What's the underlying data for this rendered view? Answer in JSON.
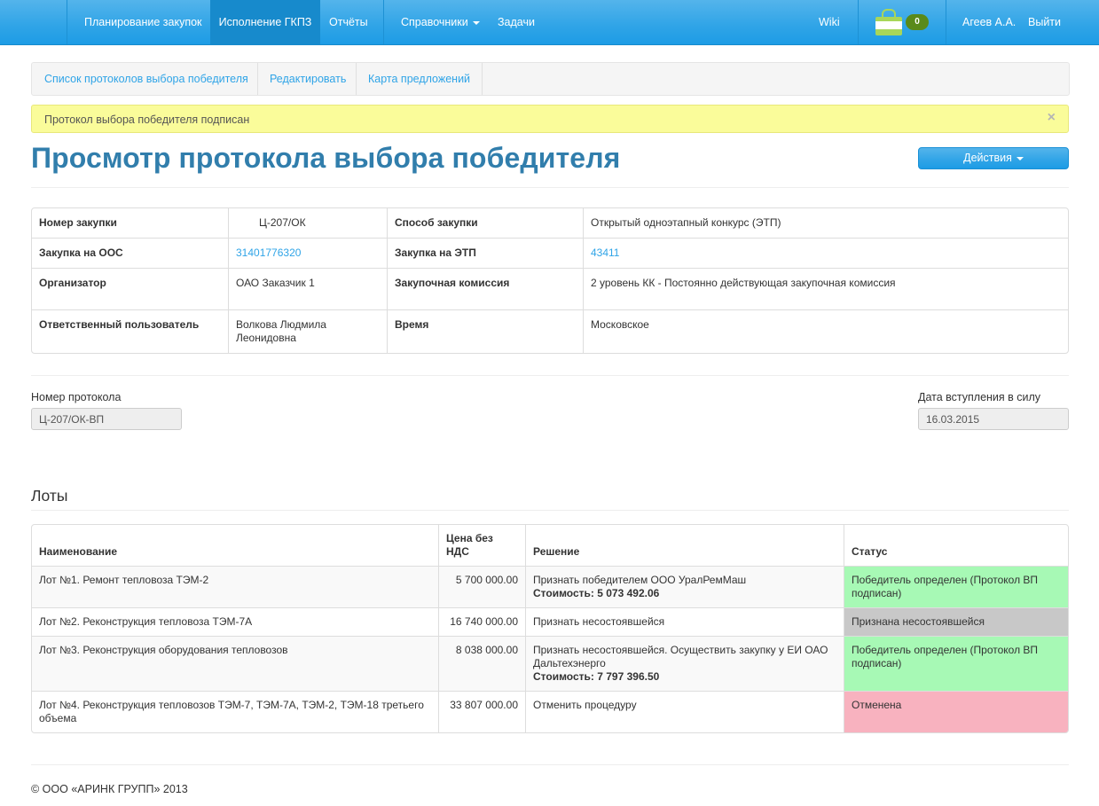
{
  "nav": {
    "planning": "Планирование закупок",
    "execution": "Исполнение ГКПЗ",
    "reports": "Отчёты",
    "references": "Справочники",
    "tasks": "Задачи",
    "wiki": "Wiki",
    "cart_count": "0",
    "user": "Агеев А.А.",
    "logout": "Выйти"
  },
  "subnav": {
    "list": "Список протоколов выбора победителя",
    "edit": "Редактировать",
    "map": "Карта предложений"
  },
  "alert": {
    "text": "Протокол выбора победителя подписан",
    "close": "×"
  },
  "page": {
    "title": "Просмотр протокола выбора победителя",
    "actions": "Действия"
  },
  "info": {
    "purchase_number_label": "Номер закупки",
    "purchase_number": "Ц-207/ОК",
    "method_label": "Способ закупки",
    "method": "Открытый одноэтапный конкурс (ЭТП)",
    "oos_label": "Закупка на ООС",
    "oos": "31401776320",
    "etp_label": "Закупка на ЭТП",
    "etp": "43411",
    "organizer_label": "Организатор",
    "organizer": "ОАО Заказчик 1",
    "commission_label": "Закупочная комиссия",
    "commission": "2 уровень КК - Постоянно действующая закупочная комиссия",
    "responsible_label": "Ответственный пользователь",
    "responsible": "Волкова Людмила Леонидовна",
    "time_label": "Время",
    "time": "Московское"
  },
  "protocol": {
    "number_label": "Номер протокола",
    "number": "Ц-207/ОК-ВП",
    "date_label": "Дата вступления в силу",
    "date": "16.03.2015"
  },
  "lots": {
    "title": "Лоты",
    "headers": {
      "name": "Наименование",
      "price": "Цена без НДС",
      "decision": "Решение",
      "status": "Статус"
    },
    "rows": [
      {
        "name": "Лот №1. Ремонт тепловоза ТЭМ-2",
        "price": "5 700 000.00",
        "decision": "Признать победителем ООО УралРемМаш",
        "cost": "Стоимость: 5 073 492.06",
        "status": "Победитель определен (Протокол ВП подписан)"
      },
      {
        "name": "Лот №2. Реконструкция тепловоза ТЭМ-7А",
        "price": "16 740 000.00",
        "decision": "Признать несостоявшейся",
        "cost": "",
        "status": "Признана несостоявшейся"
      },
      {
        "name": "Лот №3. Реконструкция оборудования тепловозов",
        "price": "8 038 000.00",
        "decision": "Признать несостоявшейся. Осуществить закупку у ЕИ ОАО Дальтехэнерго",
        "cost": "Стоимость: 7 797 396.50",
        "status": "Победитель определен (Протокол ВП подписан)"
      },
      {
        "name": "Лот №4. Реконструкция тепловозов ТЭМ-7, ТЭМ-7А, ТЭМ-2, ТЭМ-18 третьего объема",
        "price": "33 807 000.00",
        "decision": "Отменить процедуру",
        "cost": "",
        "status": "Отменена"
      }
    ]
  },
  "footer": {
    "copyright": "© ООО «АРИНК ГРУПП» 2013"
  },
  "colors": {
    "navbar": "#2fa4e7",
    "active_nav": "#178acc",
    "title": "#317eac",
    "link": "#2fa4e7",
    "alert_bg": "#fafc9a",
    "status_won": "#a7f9b5",
    "status_failed": "#c8c8c8",
    "status_cancelled": "#f8b2bf"
  },
  "icons": [
    "cart-icon",
    "close-icon",
    "chevron-down-icon"
  ]
}
